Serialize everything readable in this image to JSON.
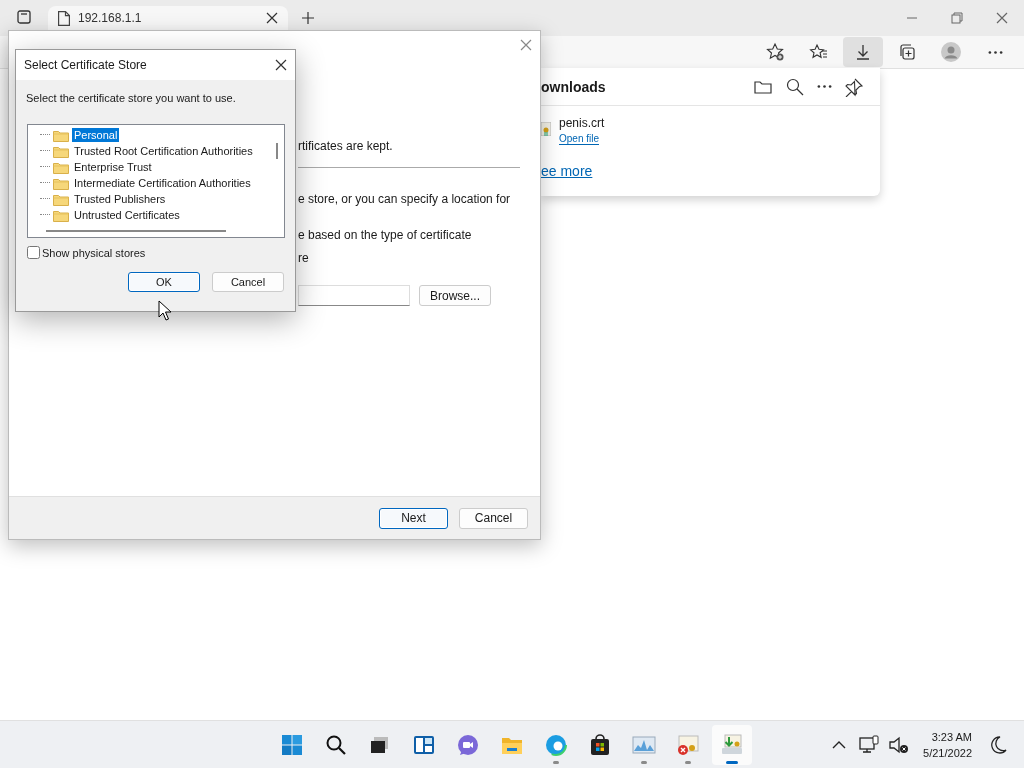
{
  "browser": {
    "tab": {
      "title": "192.168.1.1"
    },
    "toolbar": [
      {
        "kind": "favorite-add",
        "selected": false
      },
      {
        "kind": "favorites",
        "selected": false
      },
      {
        "kind": "downloads",
        "selected": true
      },
      {
        "kind": "collections",
        "selected": false
      },
      {
        "kind": "profile",
        "selected": false
      },
      {
        "kind": "more",
        "selected": false
      }
    ]
  },
  "downloads_panel": {
    "title": "ownloads",
    "items": [
      {
        "file": "penis.crt",
        "action": "Open file"
      }
    ],
    "see_more": "ee more"
  },
  "wizard": {
    "lines": [
      "rtificates are kept.",
      "e store, or you can specify a location for",
      "e based on the type of certificate",
      "re"
    ],
    "browse_button": "Browse...",
    "buttons": [
      {
        "label": "Next",
        "default": true
      },
      {
        "label": "Cancel",
        "default": false
      }
    ]
  },
  "dialog": {
    "title": "Select Certificate Store",
    "prompt": "Select the certificate store you want to use.",
    "stores": [
      {
        "label": "Personal",
        "selected": true
      },
      {
        "label": "Trusted Root Certification Authorities",
        "selected": false
      },
      {
        "label": "Enterprise Trust",
        "selected": false
      },
      {
        "label": "Intermediate Certification Authorities",
        "selected": false
      },
      {
        "label": "Trusted Publishers",
        "selected": false
      },
      {
        "label": "Untrusted Certificates",
        "selected": false
      }
    ],
    "show_physical_stores": {
      "label": "Show physical stores",
      "checked": false
    },
    "buttons": [
      {
        "label": "OK",
        "default": true
      },
      {
        "label": "Cancel",
        "default": false
      }
    ]
  },
  "taskbar": {
    "apps": [
      {
        "kind": "start",
        "running": false,
        "selected": false
      },
      {
        "kind": "search",
        "running": false,
        "selected": false
      },
      {
        "kind": "task-view",
        "running": false,
        "selected": false
      },
      {
        "kind": "widgets",
        "running": false,
        "selected": false
      },
      {
        "kind": "chat",
        "running": false,
        "selected": false
      },
      {
        "kind": "folder",
        "running": false,
        "selected": false
      },
      {
        "kind": "browser",
        "running": true,
        "selected": false
      },
      {
        "kind": "store",
        "running": false,
        "selected": false
      },
      {
        "kind": "monitor",
        "running": true,
        "selected": false
      },
      {
        "kind": "cert-error",
        "running": true,
        "selected": false
      },
      {
        "kind": "cert-install",
        "running": true,
        "selected": true
      }
    ],
    "time": "3:23 AM",
    "date": "5/21/2022"
  }
}
